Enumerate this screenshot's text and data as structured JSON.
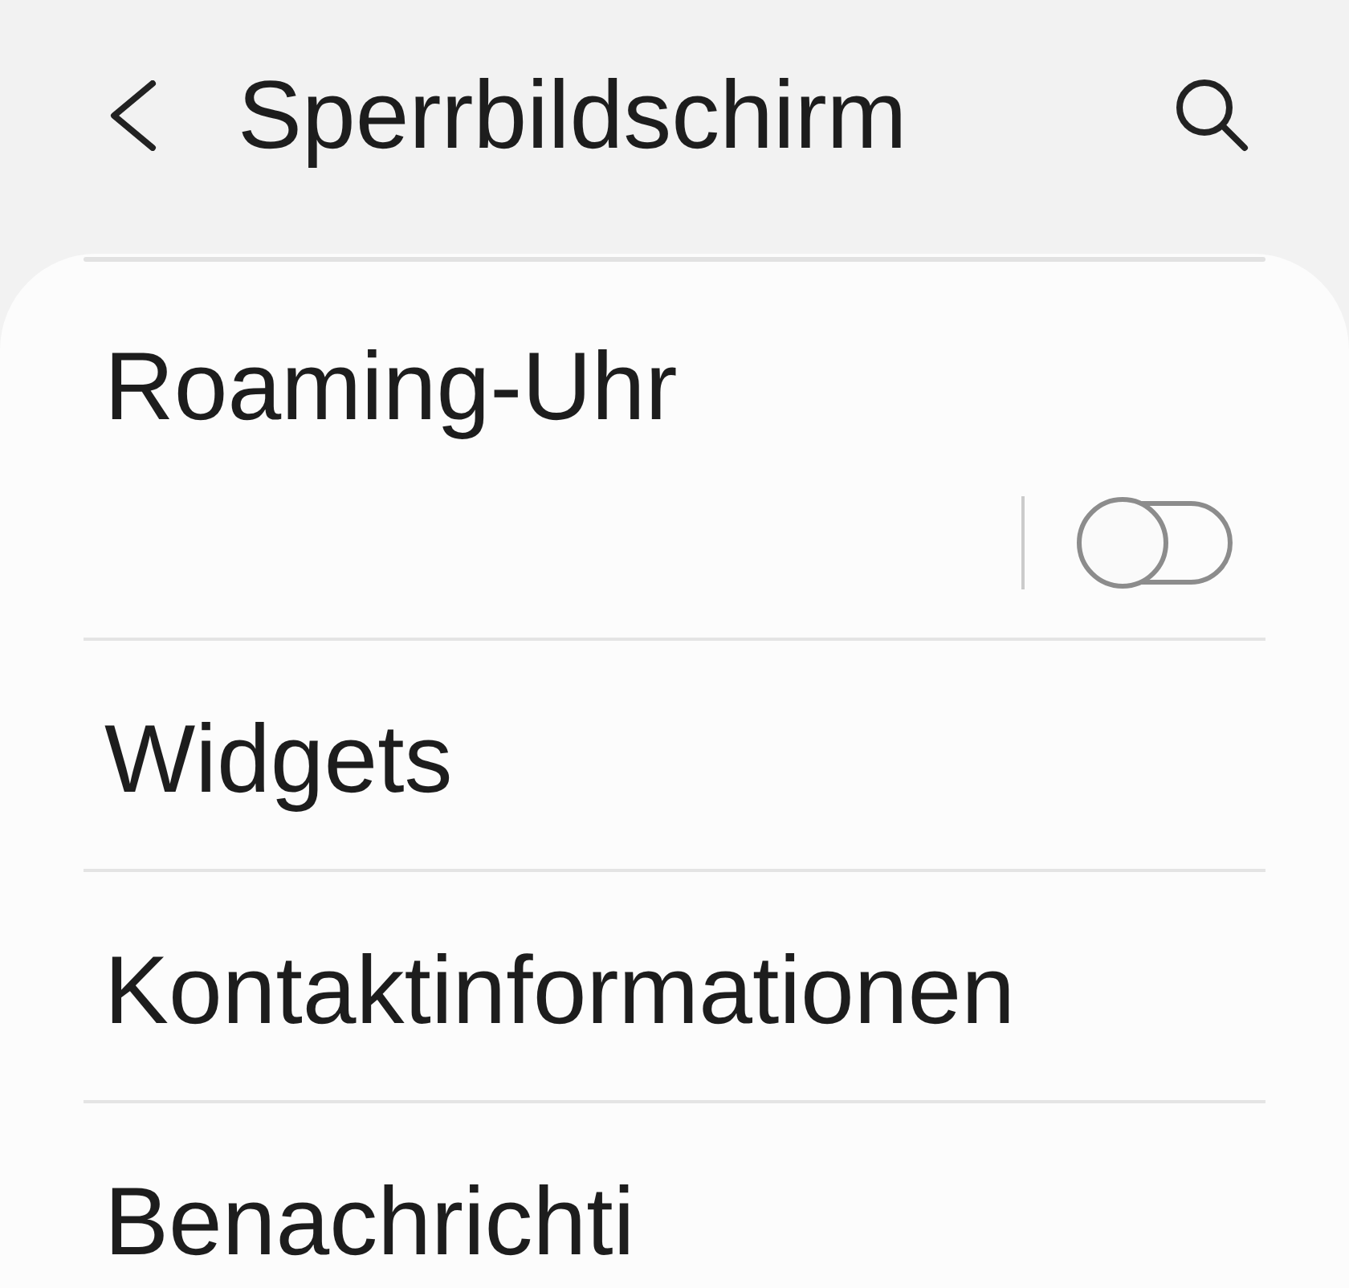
{
  "header": {
    "title": "Sperrbildschirm"
  },
  "items": [
    {
      "kind": "toggle",
      "title": "Roaming-Uhr",
      "on": false
    },
    {
      "kind": "link",
      "title": "Widgets"
    },
    {
      "kind": "link",
      "title": "Kontaktinformationen"
    },
    {
      "kind": "link",
      "title": "Benachrichti"
    }
  ]
}
